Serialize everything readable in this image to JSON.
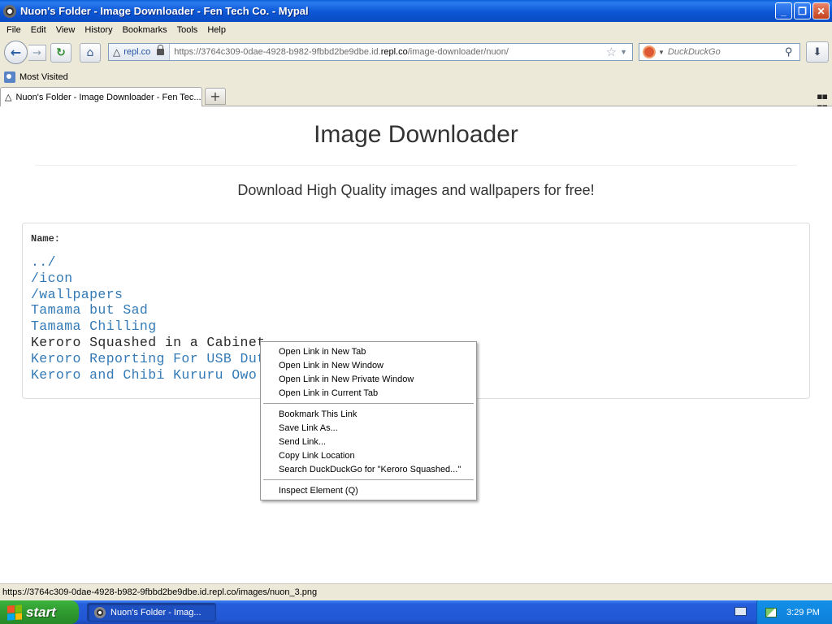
{
  "window": {
    "title": "Nuon's Folder - Image Downloader - Fen Tech Co. - Mypal",
    "buttons": {
      "minimize": "_",
      "maximize": "❐",
      "close": "✕"
    }
  },
  "menubar": [
    "File",
    "Edit",
    "View",
    "History",
    "Bookmarks",
    "Tools",
    "Help"
  ],
  "nav": {
    "identity_label": "repl.co",
    "url_prefix": "https://3764c309-0dae-4928-b982-9fbbd2be9dbe.id.",
    "url_host": "repl.co",
    "url_path": "/image-downloader/nuon/",
    "search_placeholder": "DuckDuckGo"
  },
  "bookmarks": {
    "most_visited": "Most Visited"
  },
  "tabs": [
    {
      "label": "Nuon's Folder - Image Downloader - Fen Tec..."
    }
  ],
  "page": {
    "title": "Image Downloader",
    "subtitle": "Download High Quality images and wallpapers for free!",
    "name_header": "Name:",
    "files": [
      "../",
      "/icon",
      "/wallpapers",
      "Tamama but Sad",
      "Tamama Chilling",
      "Keroro Squashed in a Cabinet",
      "Keroro Reporting For USB Duty",
      "Keroro and Chibi Kururu Owo"
    ]
  },
  "context_menu": {
    "group1": [
      "Open Link in New Tab",
      "Open Link in New Window",
      "Open Link in New Private Window",
      "Open Link in Current Tab"
    ],
    "group2": [
      "Bookmark This Link",
      "Save Link As...",
      "Send Link...",
      "Copy Link Location",
      "Search DuckDuckGo for \"Keroro Squashed...\""
    ],
    "group3": [
      "Inspect Element (Q)"
    ]
  },
  "statusbar": {
    "text": "https://3764c309-0dae-4928-b982-9fbbd2be9dbe.id.repl.co/images/nuon_3.png"
  },
  "taskbar": {
    "start_label": "start",
    "task_label": "Nuon's Folder - Imag...",
    "clock": "3:29 PM"
  },
  "colors": {
    "link": "#337ab7",
    "title_bar": "#0a5fd8",
    "taskbar": "#245edb",
    "start": "#2f9a2f"
  }
}
